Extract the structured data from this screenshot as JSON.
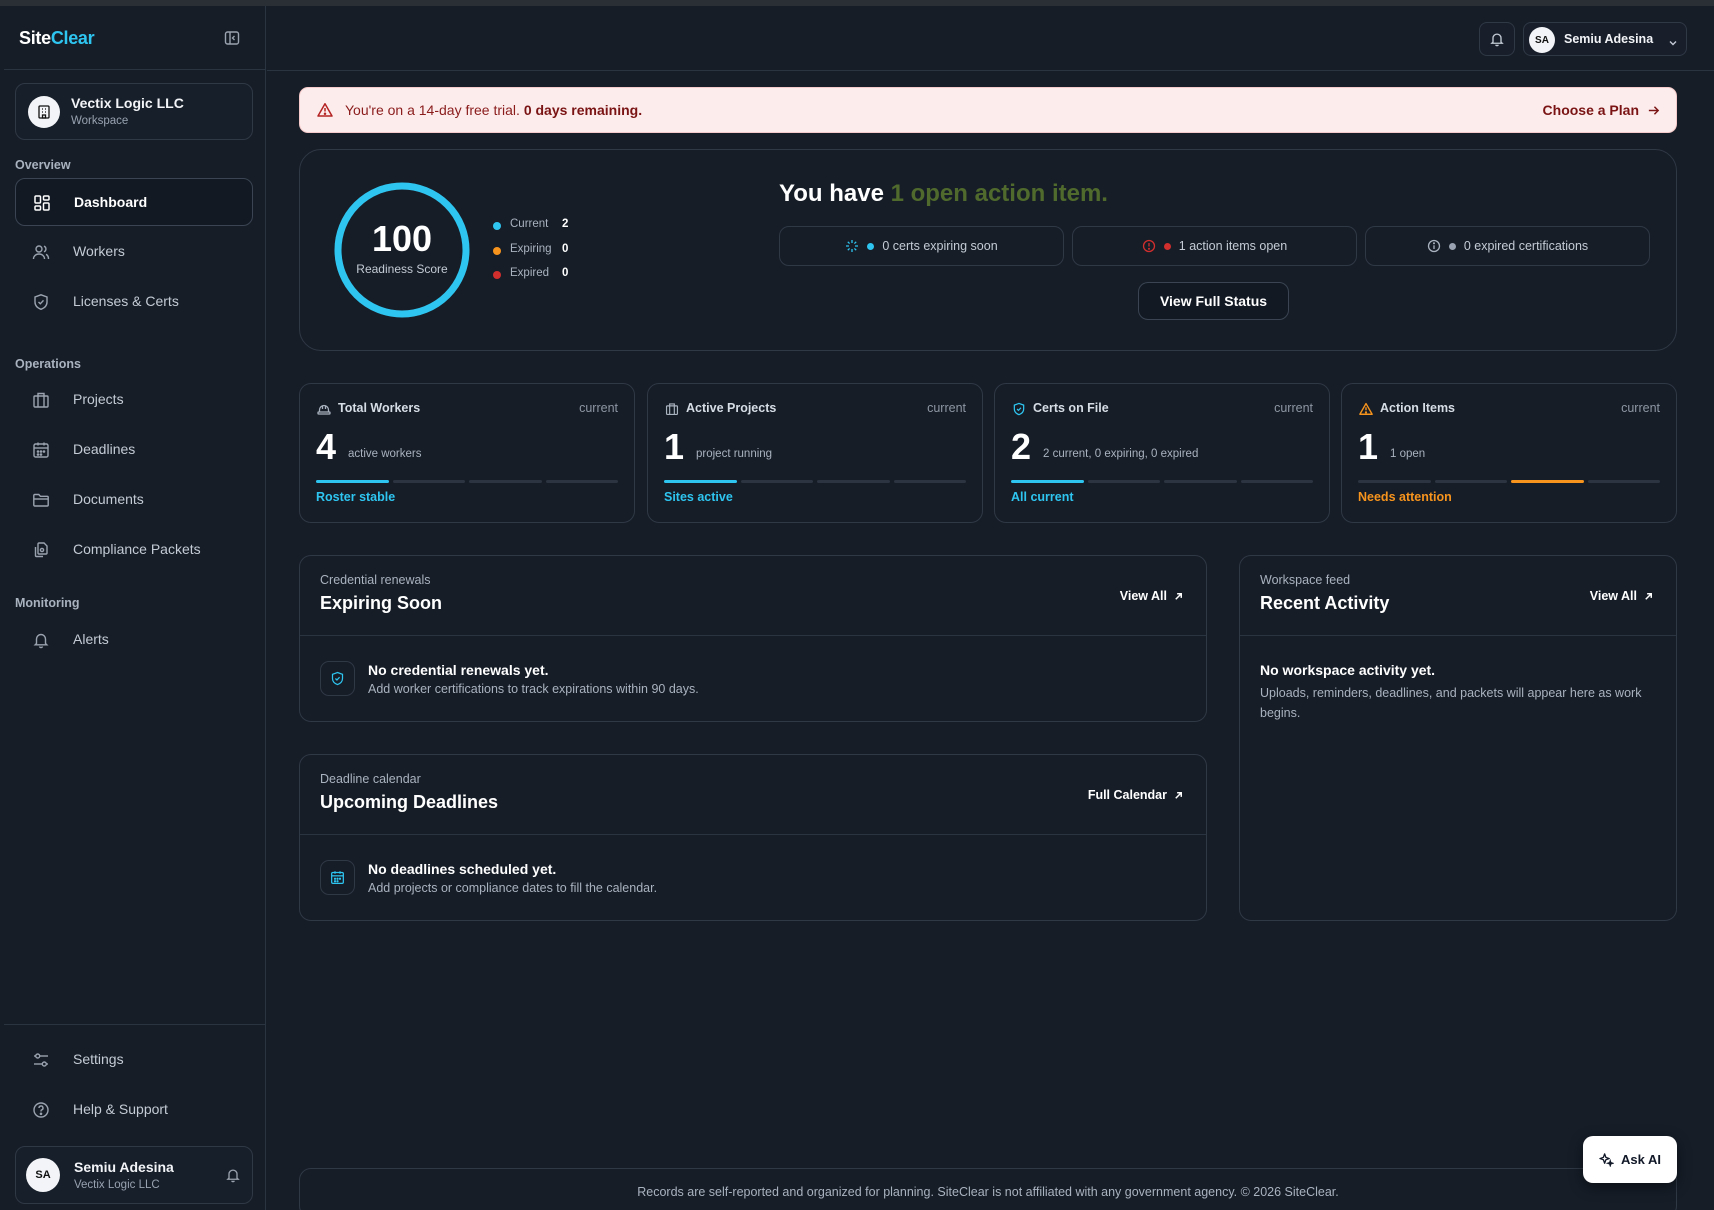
{
  "brand": {
    "part1": "Site",
    "part2": "Clear"
  },
  "workspace": {
    "name": "Vectix Logic LLC",
    "sub": "Workspace"
  },
  "nav": {
    "overview_label": "Overview",
    "operations_label": "Operations",
    "monitoring_label": "Monitoring",
    "items": [
      {
        "label": "Dashboard",
        "icon": "dashboard-icon",
        "active": true
      },
      {
        "label": "Workers",
        "icon": "users-icon"
      },
      {
        "label": "Licenses & Certs",
        "icon": "shield-icon"
      },
      {
        "label": "Projects",
        "icon": "building-icon"
      },
      {
        "label": "Deadlines",
        "icon": "calendar-icon"
      },
      {
        "label": "Documents",
        "icon": "folder-icon"
      },
      {
        "label": "Compliance Packets",
        "icon": "files-icon"
      },
      {
        "label": "Alerts",
        "icon": "bell-icon"
      }
    ],
    "settings_label": "Settings",
    "help_label": "Help & Support"
  },
  "user": {
    "initials": "SA",
    "name": "Semiu Adesina",
    "org": "Vectix Logic LLC"
  },
  "trial": {
    "message": "You're on a 14-day free trial.",
    "remaining": "0 days remaining.",
    "cta": "Choose a Plan"
  },
  "readiness": {
    "score": "100",
    "score_fraction": 1.0,
    "label": "Readiness Score",
    "legend": [
      {
        "label": "Current",
        "value": "2",
        "color": "#2ec5f0"
      },
      {
        "label": "Expiring",
        "value": "0",
        "color": "#f7941d"
      },
      {
        "label": "Expired",
        "value": "0",
        "color": "#d12e2e"
      }
    ],
    "headline_prefix": "You have",
    "headline_highlight": "1 open action item.",
    "pills": [
      {
        "text": "0 certs expiring soon",
        "icon": "sparkle-icon",
        "dot": "#2ec5f0"
      },
      {
        "text": "1 action items open",
        "icon": "alert-circle-icon",
        "dot": "#d12e2e"
      },
      {
        "text": "0 expired certifications",
        "icon": "info-circle-icon",
        "dot": "#98a2b0"
      }
    ],
    "view_status": "View Full Status"
  },
  "stats": [
    {
      "title": "Total Workers",
      "badge": "current",
      "value": "4",
      "desc": "active workers",
      "foot": "Roster stable",
      "foot_color": "#2ec5f0",
      "active_segment": 0,
      "seg_color": "#2ec5f0",
      "icon": "hardhat-icon"
    },
    {
      "title": "Active Projects",
      "badge": "current",
      "value": "1",
      "desc": "project running",
      "foot": "Sites active",
      "foot_color": "#2ec5f0",
      "active_segment": 0,
      "seg_color": "#2ec5f0",
      "icon": "building-icon"
    },
    {
      "title": "Certs on File",
      "badge": "current",
      "value": "2",
      "desc": "2 current, 0 expiring, 0 expired",
      "foot": "All current",
      "foot_color": "#2ec5f0",
      "active_segment": 0,
      "seg_color": "#2ec5f0",
      "icon": "shield-check-icon"
    },
    {
      "title": "Action Items",
      "badge": "current",
      "value": "1",
      "desc": "1 open",
      "foot": "Needs attention",
      "foot_color": "#f7941d",
      "active_segment": 2,
      "seg_color": "#f7941d",
      "icon": "warning-icon"
    }
  ],
  "expiring": {
    "kicker": "Credential renewals",
    "title": "Expiring Soon",
    "link": "View All",
    "empty_title": "No credential renewals yet.",
    "empty_desc": "Add worker certifications to track expirations within 90 days."
  },
  "deadlines": {
    "kicker": "Deadline calendar",
    "title": "Upcoming Deadlines",
    "link": "Full Calendar",
    "empty_title": "No deadlines scheduled yet.",
    "empty_desc": "Add projects or compliance dates to fill the calendar."
  },
  "activity": {
    "kicker": "Workspace feed",
    "title": "Recent Activity",
    "link": "View All",
    "empty_title": "No workspace activity yet.",
    "empty_desc": "Uploads, reminders, deadlines, and packets will appear here as work begins."
  },
  "footer": "Records are self-reported and organized for planning. SiteClear is not affiliated with any government agency. © 2026 SiteClear.",
  "ask_ai": "Ask AI"
}
